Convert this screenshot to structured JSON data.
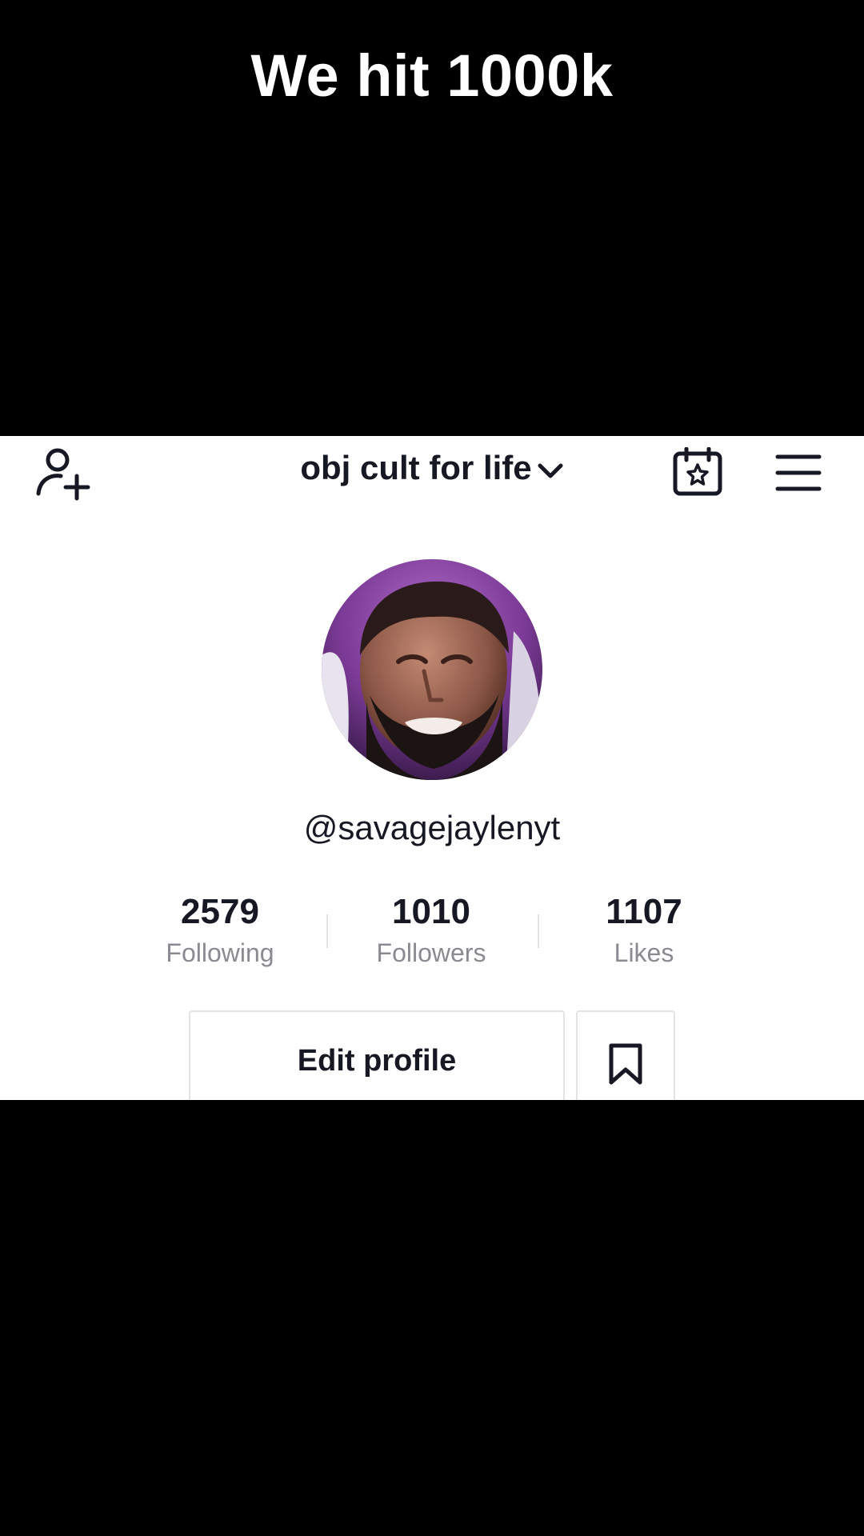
{
  "overlay": {
    "caption": "We hit 1000k"
  },
  "header": {
    "account_name": "obj cult for life",
    "icons": [
      "add-user-icon",
      "chevron-down-icon",
      "calendar-star-icon",
      "menu-icon"
    ]
  },
  "profile": {
    "username": "@savagejaylenyt",
    "stats": [
      {
        "value": "2579",
        "label": "Following"
      },
      {
        "value": "1010",
        "label": "Followers"
      },
      {
        "value": "1107",
        "label": "Likes"
      }
    ],
    "edit_label": "Edit profile",
    "bookmark_icon": "bookmark-icon"
  },
  "colors": {
    "text_primary": "#161823",
    "text_secondary": "#8a8b91",
    "border": "#e3e3e4",
    "background_outer": "#000000",
    "background_panel": "#ffffff"
  }
}
